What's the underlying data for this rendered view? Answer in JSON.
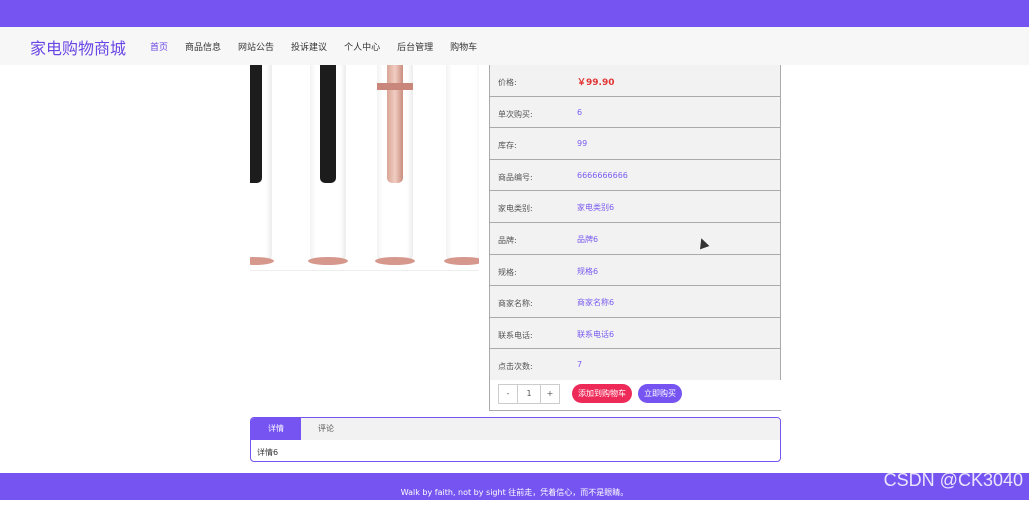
{
  "header": {
    "brand": "家电购物商城",
    "nav": [
      "首页",
      "商品信息",
      "网站公告",
      "投诉建议",
      "个人中心",
      "后台管理",
      "购物车"
    ]
  },
  "product": {
    "rows": [
      {
        "label": "价格:",
        "value": "￥99.90"
      },
      {
        "label": "单次购买:",
        "value": "6"
      },
      {
        "label": "库存:",
        "value": "99"
      },
      {
        "label": "商品编号:",
        "value": "6666666666"
      },
      {
        "label": "家电类别:",
        "value": "家电类别6"
      },
      {
        "label": "品牌:",
        "value": "品牌6"
      },
      {
        "label": "规格:",
        "value": "规格6"
      },
      {
        "label": "商家名称:",
        "value": "商家名称6"
      },
      {
        "label": "联系电话:",
        "value": "联系电话6"
      },
      {
        "label": "点击次数:",
        "value": "7"
      }
    ],
    "stepper": {
      "minus": "-",
      "qty": "1",
      "plus": "+"
    },
    "add_cart_label": "添加到购物车",
    "buy_now_label": "立即购买"
  },
  "tabs": {
    "items": [
      "详情",
      "评论"
    ],
    "content": "详情6"
  },
  "footer": {
    "text": "Walk by faith, not by sight 往前走，凭着信心，而不是眼睛。"
  },
  "watermark": "CSDN @CK3040",
  "colors": {
    "accent": "#7554f2",
    "cart": "#ee2a59",
    "price": "#e23535"
  }
}
